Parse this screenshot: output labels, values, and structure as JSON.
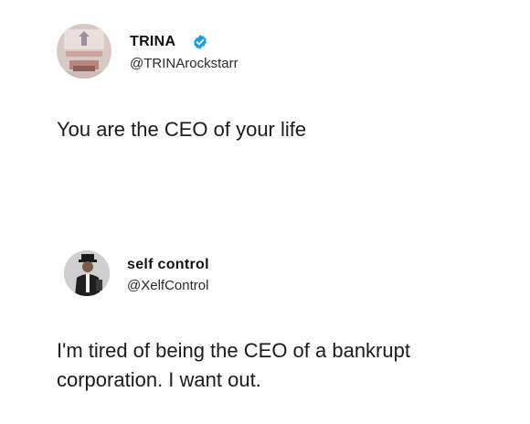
{
  "tweets": [
    {
      "display_name": "TRINA",
      "handle": "@TRINArockstarr",
      "verified": true,
      "text": "You are the CEO of your life",
      "avatar_icon": "profile-photo"
    },
    {
      "display_name": "self control",
      "handle": "@XelfControl",
      "verified": false,
      "text": "I'm tired of being the CEO of a bankrupt corporation. I want out.",
      "avatar_icon": "profile-photo"
    }
  ],
  "colors": {
    "background": "#ffffff",
    "text": "#1b1b1b",
    "verified_badge": "#1d9bf0"
  }
}
